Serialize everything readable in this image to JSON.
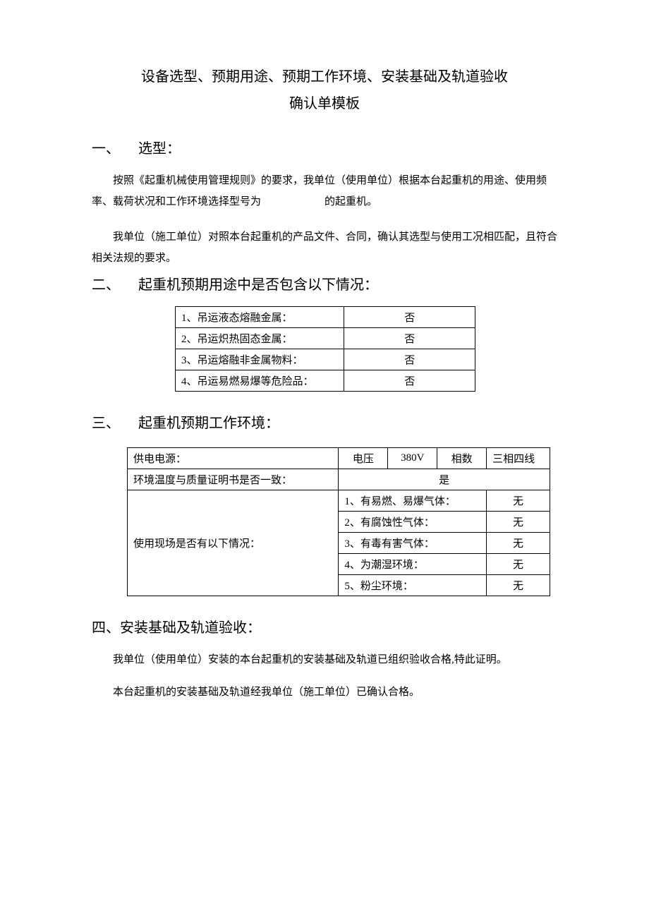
{
  "title_line1": "设备选型、预期用途、预期工作环境、安装基础及轨道验收",
  "title_line2": "确认单模板",
  "sec1": {
    "num": "一、",
    "heading": "选型：",
    "p1a": "按照《起重机械使用管理规则》的要求，我单位（使用单位）根据本台起重机的用途、使用频率、载荷状况和工作环境选择型号为",
    "blank": "",
    "p1b": "的起重机。",
    "p2": "我单位（施工单位）对照本台起重机的产品文件、合同，确认其选型与使用工况相匹配，且符合相关法规的要求。"
  },
  "sec2": {
    "num": "二、",
    "heading": "起重机预期用途中是否包含以下情况：",
    "rows": [
      {
        "label": "1、吊运液态熔融金属：",
        "value": "否"
      },
      {
        "label": "2、吊运炽热固态金属：",
        "value": "否"
      },
      {
        "label": "3、吊运熔融非金属物料：",
        "value": "否"
      },
      {
        "label": "4、吊运易燃易爆等危险品：",
        "value": "否"
      }
    ]
  },
  "sec3": {
    "num": "三、",
    "heading": "起重机预期工作环境：",
    "power_label": "供电电源：",
    "voltage_label": "电压",
    "voltage_value": "380V",
    "phase_label": "相数",
    "phase_value": "三相四线",
    "temp_label": "环境温度与质量证明书是否一致：",
    "temp_value": "是",
    "cond_label": "使用现场是否有以下情况：",
    "conds": [
      {
        "label": "1、有易燃、易爆气体：",
        "value": "无"
      },
      {
        "label": "2、有腐蚀性气体：",
        "value": "无"
      },
      {
        "label": "3、有毒有害气体：",
        "value": "无"
      },
      {
        "label": "4、为潮湿环境：",
        "value": "无"
      },
      {
        "label": "5、粉尘环境：",
        "value": "无"
      }
    ]
  },
  "sec4": {
    "num": "四、",
    "heading": "安装基础及轨道验收：",
    "p1": "我单位（使用单位）安装的本台起重机的安装基础及轨道已组织验收合格,特此证明。",
    "p2": "本台起重机的安装基础及轨道经我单位（施工单位）已确认合格。"
  }
}
